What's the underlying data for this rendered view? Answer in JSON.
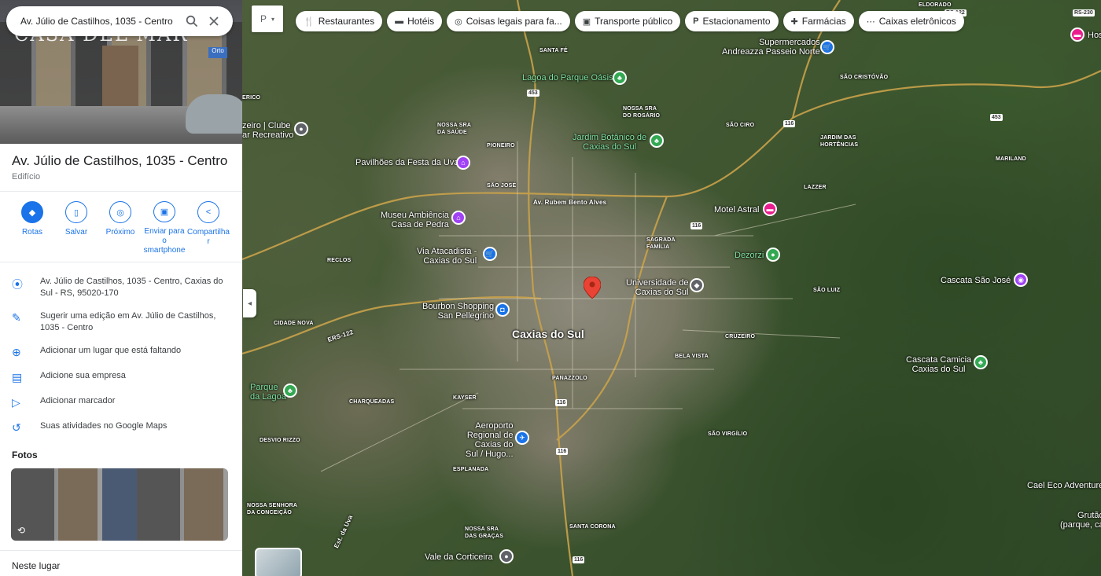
{
  "search": {
    "value": "Av. Júlio de Castilhos, 1035 - Centro",
    "search_icon": "search-icon",
    "close_icon": "close-icon"
  },
  "hero": {
    "signage": "CASA DEL MAR",
    "sign_small": "Orto"
  },
  "place": {
    "title": "Av. Júlio de Castilhos, 1035 - Centro",
    "type": "Edifício"
  },
  "actions": [
    {
      "label": "Rotas",
      "icon": "directions-icon"
    },
    {
      "label": "Salvar",
      "icon": "bookmark-icon"
    },
    {
      "label": "Próximo",
      "icon": "nearby-icon"
    },
    {
      "label": "Enviar para o smartphone",
      "icon": "send-to-phone-icon"
    },
    {
      "label": "Compartilhar",
      "icon": "share-icon"
    }
  ],
  "info": [
    {
      "icon": "location-pin-icon",
      "text": "Av. Júlio de Castilhos, 1035 - Centro, Caxias do Sul - RS, 95020-170"
    },
    {
      "icon": "pencil-icon",
      "text": "Sugerir uma edição em Av. Júlio de Castilhos, 1035 - Centro"
    },
    {
      "icon": "add-place-icon",
      "text": "Adicionar um lugar que está faltando"
    },
    {
      "icon": "add-business-icon",
      "text": "Adicione sua empresa"
    },
    {
      "icon": "label-icon",
      "text": "Adicionar marcador"
    },
    {
      "icon": "history-icon",
      "text": "Suas atividades no Google Maps"
    }
  ],
  "photos_heading": "Fotos",
  "nearby_heading": "Neste lugar",
  "chips": [
    {
      "label": "Restaurantes",
      "icon": "restaurant-icon"
    },
    {
      "label": "Hotéis",
      "icon": "hotel-icon"
    },
    {
      "label": "Coisas legais para fa...",
      "icon": "camera-icon"
    },
    {
      "label": "Transporte público",
      "icon": "transit-icon"
    },
    {
      "label": "Estacionamento",
      "icon": "parking-icon"
    },
    {
      "label": "Farmácias",
      "icon": "pharmacy-icon"
    },
    {
      "label": "Caixas eletrônicos",
      "icon": "atm-icon"
    }
  ],
  "map": {
    "city": "Caxias do Sul",
    "places": [
      "Supermercados Andreazza Passeio Norte",
      "Lagoa do Parque Oásis",
      "Jardim Botânico de Caxias do Sul",
      "Pavilhões da Festa da Uva",
      "Museu Ambiência Casa de Pedra",
      "Motel Astral",
      "Via Atacadista - Caxias do Sul",
      "Dezorzi",
      "Universidade de Caxias do Sul",
      "Bourbon Shopping San Pellegrino",
      "Cascata São José",
      "Cascata Camicia Caxias do Sul",
      "Parque da Lagoa",
      "Aeroporto Regional de Caxias do Sul / Hugo...",
      "Vale da Corticeira",
      "Cael Eco Adventure",
      "Grutão (parque, ca",
      "zeiro | Clube ar Recreativo",
      "Hos"
    ],
    "neighborhoods": [
      "SANTA FÉ",
      "NOSSA SRA DO ROSÁRIO",
      "SÃO CRISTÓVÃO",
      "NOSSA SRA DA SAÚDE",
      "PIONEIRO",
      "SÃO CIRO",
      "JARDIM DAS HORTÊNCIAS",
      "MARILAND",
      "SÃO JOSÉ",
      "LAZZER",
      "SAGRADA FAMÍLIA",
      "RECLOS",
      "SÃO LUIZ",
      "CIDADE NOVA",
      "CRUZEIRO",
      "BELA VISTA",
      "PANAZZOLO",
      "CHARQUEADAS",
      "KAYSER",
      "SÃO VIRGÍLIO",
      "DESVIO RIZZO",
      "ESPLANADA",
      "NOSSA SENHORA DA CONCEIÇÃO",
      "NOSSA SRA DAS GRAÇAS",
      "SANTA CORONA",
      "ELDORADO",
      "ERICO"
    ],
    "streets": [
      "Av. Rubem Bento Alves",
      "Est. da Uva",
      "ERS-122"
    ],
    "road_shields": [
      "453",
      "116",
      "116",
      "116",
      "116",
      "453",
      "116",
      "RS-122",
      "RS-230"
    ]
  },
  "colors": {
    "accent": "#1a73e8",
    "pin": "#ea4335"
  }
}
